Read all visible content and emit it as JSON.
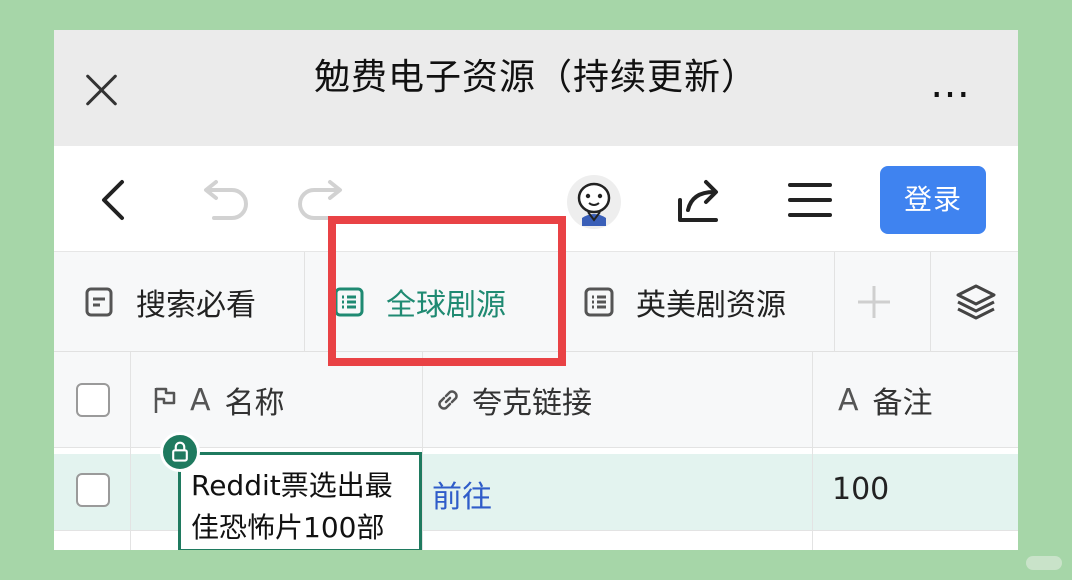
{
  "window": {
    "title": "勉费电子资源（持续更新）",
    "more_label": "…"
  },
  "toolbar": {
    "login_label": "登录",
    "icons": [
      "back-arrow-icon",
      "undo-icon",
      "redo-icon",
      "avatar",
      "share-icon",
      "menu-icon"
    ]
  },
  "tabs": [
    {
      "label": "搜索必看",
      "icon": "doc-icon",
      "active": false
    },
    {
      "label": "全球剧源",
      "icon": "table-list-icon",
      "active": true
    },
    {
      "label": "英美剧资源",
      "icon": "table-list-icon",
      "active": false
    }
  ],
  "table": {
    "columns": [
      {
        "icon": "flag-icon",
        "type_label": "A",
        "label": "名称"
      },
      {
        "icon": "link-icon",
        "label": "夸克链接"
      },
      {
        "type_label": "A",
        "label": "备注"
      }
    ],
    "rows": [
      {
        "name": "Reddit票选出最佳恐怖片100部",
        "link_text": "前往",
        "note": "100"
      }
    ]
  },
  "colors": {
    "background": "#a6d6a8",
    "accent_green": "#1f8a72",
    "login_blue": "#3f83f0",
    "highlight_red": "#e94245",
    "link_blue": "#2f5cc9"
  }
}
